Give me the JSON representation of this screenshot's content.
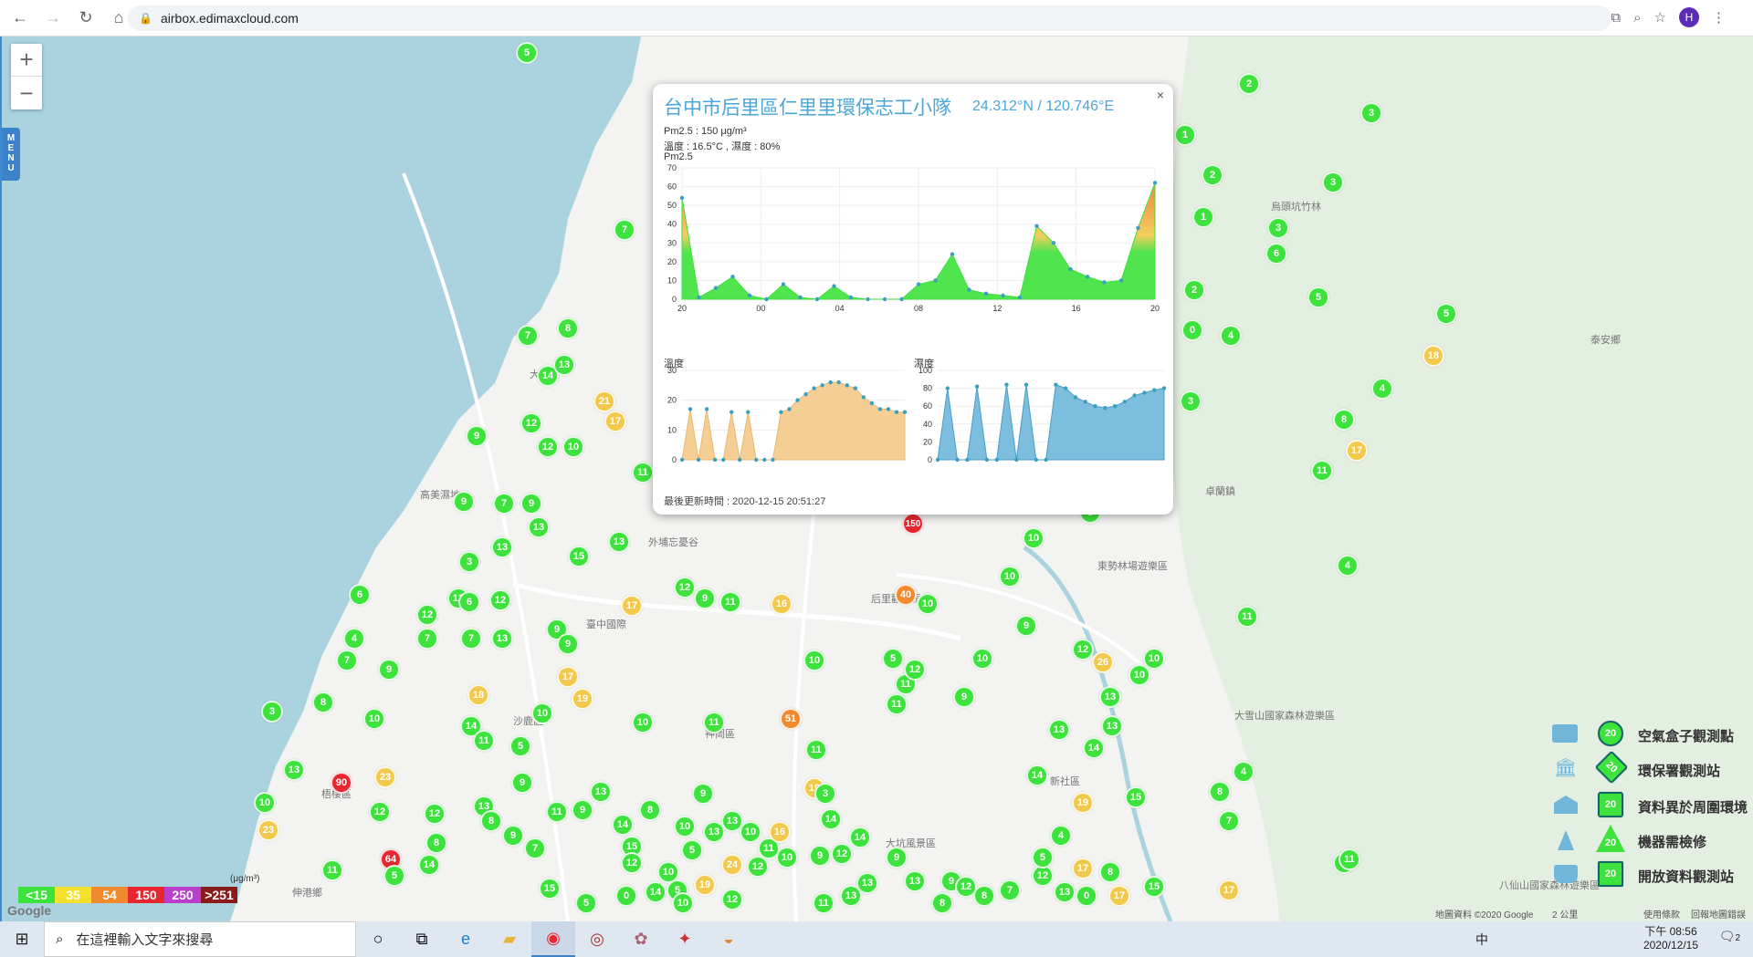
{
  "browser": {
    "url": "airbox.edimaxcloud.com",
    "profile_initial": "H"
  },
  "map": {
    "menu_label": "MENU",
    "zoom_in": "+",
    "zoom_out": "−",
    "places": [
      "大安區",
      "高美濕地",
      "外埔忘憂谷",
      "后里觀光馬場",
      "臺中國際",
      "沙鹿區",
      "梧棲區",
      "神岡區",
      "大坑風景區",
      "新社區",
      "東勢林場遊樂區",
      "卓蘭鎮",
      "烏頭坑竹林",
      "泰安鄉",
      "八仙山國家森林遊樂區",
      "大雪山國家森林遊樂區",
      "伸港鄉"
    ],
    "google": "Google",
    "footer_data": "地圖資料 ©2020 Google",
    "footer_scale": "2 公里",
    "footer_terms": "使用條款",
    "footer_report": "回報地圖錯誤"
  },
  "popup": {
    "title": "台中市后里區仁里里環保志工小隊",
    "coord": "24.312°N / 120.746°E",
    "pm_line": "Pm2.5 : 150 μg/m³",
    "temp_line": "溫度 : 16.5°C , 濕度 : 80%",
    "chart_title": "Pm2.5",
    "temp_title": "溫度",
    "hum_title": "濕度",
    "updated": "最後更新時間 : 2020-12-15 20:51:27",
    "close": "×"
  },
  "chart_data": [
    {
      "type": "area",
      "title": "Pm2.5",
      "x": [
        "20",
        "00",
        "04",
        "08",
        "12",
        "16",
        "20"
      ],
      "ylim": [
        0,
        70
      ],
      "yticks": [
        0,
        10,
        20,
        30,
        40,
        50,
        60,
        70
      ],
      "values": [
        54,
        1,
        6,
        12,
        2,
        0,
        8,
        1,
        0,
        7,
        1,
        0,
        0,
        0,
        8,
        10,
        24,
        5,
        3,
        2,
        1,
        39,
        30,
        16,
        12,
        9,
        10,
        38,
        62
      ]
    },
    {
      "type": "area",
      "title": "溫度",
      "ylim": [
        0,
        30
      ],
      "yticks": [
        0,
        10,
        20,
        30
      ],
      "values": [
        0,
        17,
        0,
        17,
        0,
        0,
        16,
        0,
        16,
        0,
        0,
        0,
        16,
        17,
        20,
        22,
        24,
        25,
        26,
        26,
        25,
        24,
        21,
        19,
        17,
        17,
        16,
        16
      ]
    },
    {
      "type": "area",
      "title": "濕度",
      "ylim": [
        0,
        100
      ],
      "yticks": [
        0,
        20,
        40,
        60,
        80,
        100
      ],
      "values": [
        0,
        80,
        0,
        0,
        82,
        0,
        0,
        84,
        0,
        84,
        0,
        0,
        84,
        80,
        70,
        65,
        60,
        58,
        60,
        65,
        72,
        75,
        78,
        80
      ]
    }
  ],
  "legend": {
    "items": [
      "空氣盒子觀測點",
      "環保署觀測站",
      "資料異於周圍環境",
      "機器需檢修",
      "開放資料觀測站"
    ],
    "icon_value": "20",
    "unit": "(μg/m³)",
    "scale": [
      "<15",
      "35",
      "54",
      "150",
      "250",
      ">251"
    ],
    "scale_colors": [
      "#3de23c",
      "#f2e22c",
      "#f08a2c",
      "#e8262f",
      "#b93ec9",
      "#8b1a1a"
    ]
  },
  "markers": {
    "popup_marker": "150"
  },
  "taskbar": {
    "search_placeholder": "在這裡輸入文字來搜尋",
    "time_prefix": "下午 08:56",
    "date": "2020/12/15",
    "lang": "中",
    "notif": "2"
  }
}
